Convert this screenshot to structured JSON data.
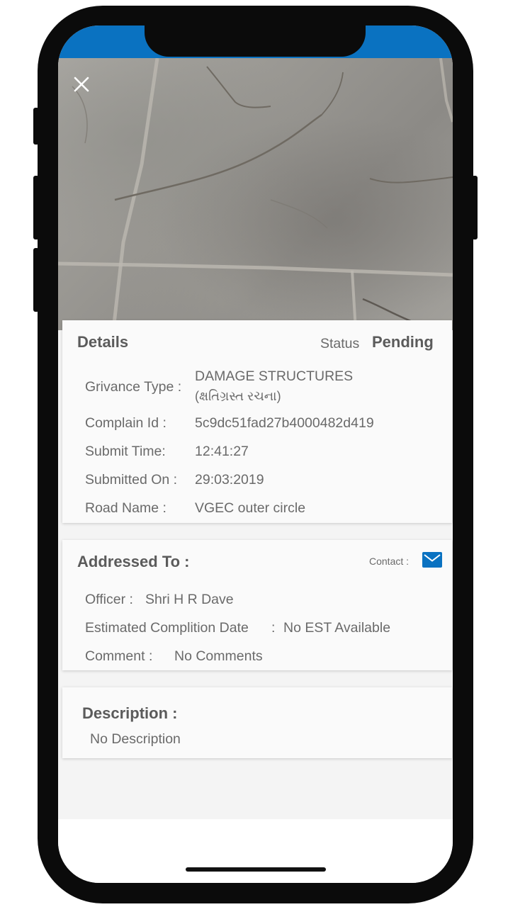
{
  "photo": {
    "close_icon": "close-icon"
  },
  "details": {
    "title": "Details",
    "status_label": "Status",
    "status_value": "Pending",
    "rows": [
      {
        "label": "Grivance Type :",
        "value": "DAMAGE STRUCTURES",
        "value2": "(ક્ષતિગ્રસ્ત રચના)"
      },
      {
        "label": "Complain Id :",
        "value": "5c9dc51fad27b4000482d419"
      },
      {
        "label": "Submit Time:",
        "value": "12:41:27"
      },
      {
        "label": "Submitted On :",
        "value": "29:03:2019"
      },
      {
        "label": "Road Name :",
        "value": "VGEC outer circle"
      }
    ]
  },
  "addressed": {
    "title": "Addressed To :",
    "contact_label": "Contact :",
    "contact_icon": "mail-icon",
    "officer_label": "Officer :",
    "officer_value": "Shri H R Dave",
    "est_label": "Estimated Complition Date",
    "est_sep": ":",
    "est_value": "No EST Available",
    "comment_label": "Comment :",
    "comment_value": "No Comments"
  },
  "description": {
    "title": "Description :",
    "value": "No Description"
  },
  "colors": {
    "accent": "#0a72c1",
    "text": "#6a6a6a",
    "heading": "#5b5b5b"
  }
}
